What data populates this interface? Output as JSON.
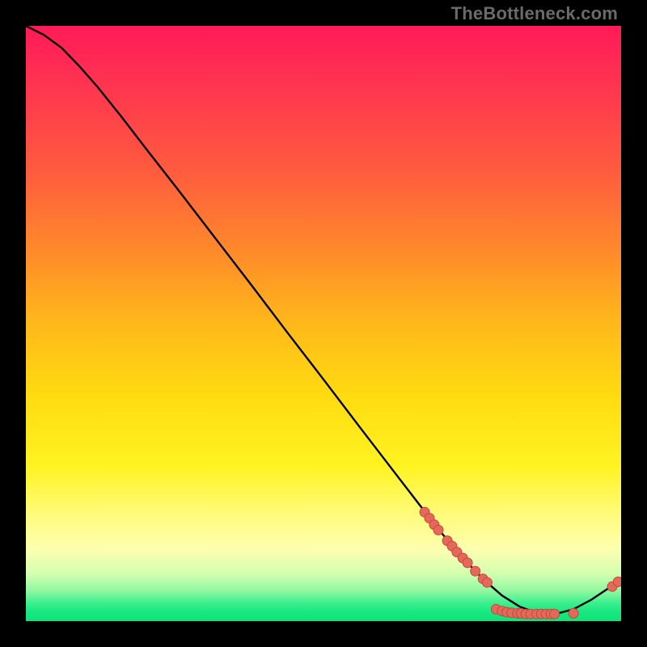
{
  "watermark": "TheBottleneck.com",
  "colors": {
    "curve": "#000000",
    "marker_fill": "#e4695b",
    "marker_stroke": "#c6473d",
    "bg_top": "#ff1a58",
    "bg_mid": "#ffdb10",
    "bg_bottom": "#17e87f",
    "frame": "#000000"
  },
  "chart_data": {
    "type": "line",
    "title": "",
    "xlabel": "",
    "ylabel": "",
    "xlim": [
      0,
      100
    ],
    "ylim": [
      0,
      100
    ],
    "grid": false,
    "curve": [
      {
        "x": 0,
        "y": 100
      },
      {
        "x": 3,
        "y": 98.5
      },
      {
        "x": 6,
        "y": 96.3
      },
      {
        "x": 9,
        "y": 93.2
      },
      {
        "x": 12,
        "y": 89.8
      },
      {
        "x": 16,
        "y": 84.8
      },
      {
        "x": 20,
        "y": 79.6
      },
      {
        "x": 26,
        "y": 71.9
      },
      {
        "x": 32,
        "y": 64.1
      },
      {
        "x": 38,
        "y": 56.3
      },
      {
        "x": 44,
        "y": 48.4
      },
      {
        "x": 50,
        "y": 40.6
      },
      {
        "x": 56,
        "y": 32.7
      },
      {
        "x": 62,
        "y": 24.9
      },
      {
        "x": 66,
        "y": 19.7
      },
      {
        "x": 70,
        "y": 14.6
      },
      {
        "x": 74,
        "y": 10.0
      },
      {
        "x": 77,
        "y": 6.9
      },
      {
        "x": 80,
        "y": 4.3
      },
      {
        "x": 83,
        "y": 2.4
      },
      {
        "x": 86,
        "y": 1.3
      },
      {
        "x": 89,
        "y": 1.2
      },
      {
        "x": 92,
        "y": 2.0
      },
      {
        "x": 95,
        "y": 3.6
      },
      {
        "x": 98,
        "y": 5.6
      },
      {
        "x": 100,
        "y": 7.0
      }
    ],
    "markers": [
      {
        "x": 67.0,
        "y": 18.3
      },
      {
        "x": 67.8,
        "y": 17.3
      },
      {
        "x": 68.6,
        "y": 16.2
      },
      {
        "x": 69.3,
        "y": 15.3
      },
      {
        "x": 70.8,
        "y": 13.5
      },
      {
        "x": 71.6,
        "y": 12.6
      },
      {
        "x": 72.4,
        "y": 11.6
      },
      {
        "x": 73.4,
        "y": 10.6
      },
      {
        "x": 74.2,
        "y": 9.8
      },
      {
        "x": 75.5,
        "y": 8.4
      },
      {
        "x": 76.8,
        "y": 7.1
      },
      {
        "x": 77.5,
        "y": 6.5
      },
      {
        "x": 79.0,
        "y": 2.0
      },
      {
        "x": 80.0,
        "y": 1.7
      },
      {
        "x": 80.8,
        "y": 1.5
      },
      {
        "x": 81.6,
        "y": 1.4
      },
      {
        "x": 82.6,
        "y": 1.3
      },
      {
        "x": 83.2,
        "y": 1.3
      },
      {
        "x": 84.0,
        "y": 1.2
      },
      {
        "x": 84.8,
        "y": 1.2
      },
      {
        "x": 85.8,
        "y": 1.2
      },
      {
        "x": 86.6,
        "y": 1.2
      },
      {
        "x": 87.4,
        "y": 1.2
      },
      {
        "x": 88.2,
        "y": 1.2
      },
      {
        "x": 88.8,
        "y": 1.2
      },
      {
        "x": 92.0,
        "y": 1.3
      },
      {
        "x": 98.5,
        "y": 5.8
      },
      {
        "x": 99.5,
        "y": 6.6
      }
    ]
  }
}
